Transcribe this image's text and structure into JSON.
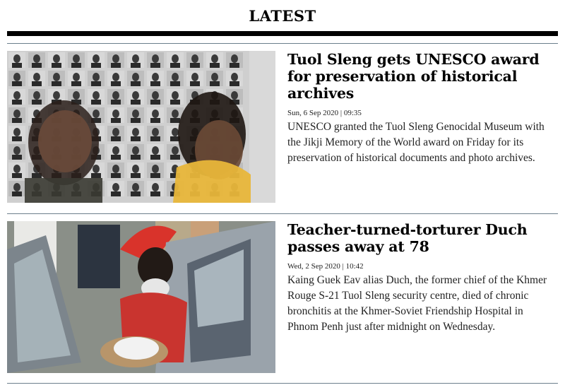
{
  "section": {
    "title": "LATEST"
  },
  "articles": [
    {
      "headline": "Tuol Sleng gets UNESCO award for preservation of historical archives",
      "date": "Sun, 6 Sep 2020 | 09:35",
      "summary": "UNESCO granted the Tuol Sleng Genocidal Museum with the Jikji Memory of the World award on Friday for its preservation of historical documents and photo archives.",
      "image_icon": "photo-wall-visitors"
    },
    {
      "headline": "Teacher-turned-torturer Duch passes away at 78",
      "date": "Wed, 2 Sep 2020 | 10:42",
      "summary": "Kaing Guek Eav alias Duch, the former chief of the Khmer Rouge S-21 Tuol Sleng security centre, died of chronic bronchitis at the Khmer-Soviet Friendship Hospital in Phnom Penh just after midnight on Wednesday.",
      "image_icon": "people-at-car"
    }
  ],
  "colors": {
    "rule_thick": "#000000",
    "rule_thin": "#6b7f8c",
    "headline": "#000000",
    "body_text": "#222222"
  }
}
